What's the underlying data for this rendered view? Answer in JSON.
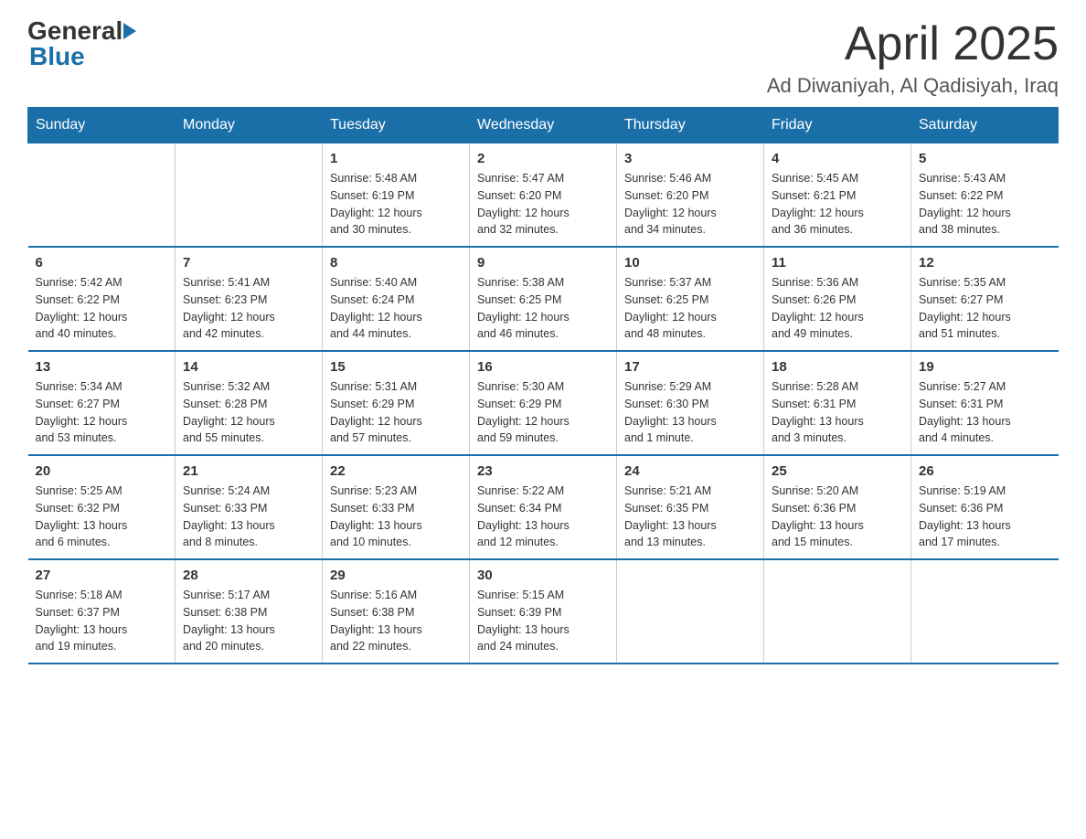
{
  "logo": {
    "text_general": "General",
    "text_blue": "Blue"
  },
  "header": {
    "title": "April 2025",
    "subtitle": "Ad Diwaniyah, Al Qadisiyah, Iraq"
  },
  "days_of_week": [
    "Sunday",
    "Monday",
    "Tuesday",
    "Wednesday",
    "Thursday",
    "Friday",
    "Saturday"
  ],
  "weeks": [
    [
      {
        "day": "",
        "info": ""
      },
      {
        "day": "",
        "info": ""
      },
      {
        "day": "1",
        "info": "Sunrise: 5:48 AM\nSunset: 6:19 PM\nDaylight: 12 hours\nand 30 minutes."
      },
      {
        "day": "2",
        "info": "Sunrise: 5:47 AM\nSunset: 6:20 PM\nDaylight: 12 hours\nand 32 minutes."
      },
      {
        "day": "3",
        "info": "Sunrise: 5:46 AM\nSunset: 6:20 PM\nDaylight: 12 hours\nand 34 minutes."
      },
      {
        "day": "4",
        "info": "Sunrise: 5:45 AM\nSunset: 6:21 PM\nDaylight: 12 hours\nand 36 minutes."
      },
      {
        "day": "5",
        "info": "Sunrise: 5:43 AM\nSunset: 6:22 PM\nDaylight: 12 hours\nand 38 minutes."
      }
    ],
    [
      {
        "day": "6",
        "info": "Sunrise: 5:42 AM\nSunset: 6:22 PM\nDaylight: 12 hours\nand 40 minutes."
      },
      {
        "day": "7",
        "info": "Sunrise: 5:41 AM\nSunset: 6:23 PM\nDaylight: 12 hours\nand 42 minutes."
      },
      {
        "day": "8",
        "info": "Sunrise: 5:40 AM\nSunset: 6:24 PM\nDaylight: 12 hours\nand 44 minutes."
      },
      {
        "day": "9",
        "info": "Sunrise: 5:38 AM\nSunset: 6:25 PM\nDaylight: 12 hours\nand 46 minutes."
      },
      {
        "day": "10",
        "info": "Sunrise: 5:37 AM\nSunset: 6:25 PM\nDaylight: 12 hours\nand 48 minutes."
      },
      {
        "day": "11",
        "info": "Sunrise: 5:36 AM\nSunset: 6:26 PM\nDaylight: 12 hours\nand 49 minutes."
      },
      {
        "day": "12",
        "info": "Sunrise: 5:35 AM\nSunset: 6:27 PM\nDaylight: 12 hours\nand 51 minutes."
      }
    ],
    [
      {
        "day": "13",
        "info": "Sunrise: 5:34 AM\nSunset: 6:27 PM\nDaylight: 12 hours\nand 53 minutes."
      },
      {
        "day": "14",
        "info": "Sunrise: 5:32 AM\nSunset: 6:28 PM\nDaylight: 12 hours\nand 55 minutes."
      },
      {
        "day": "15",
        "info": "Sunrise: 5:31 AM\nSunset: 6:29 PM\nDaylight: 12 hours\nand 57 minutes."
      },
      {
        "day": "16",
        "info": "Sunrise: 5:30 AM\nSunset: 6:29 PM\nDaylight: 12 hours\nand 59 minutes."
      },
      {
        "day": "17",
        "info": "Sunrise: 5:29 AM\nSunset: 6:30 PM\nDaylight: 13 hours\nand 1 minute."
      },
      {
        "day": "18",
        "info": "Sunrise: 5:28 AM\nSunset: 6:31 PM\nDaylight: 13 hours\nand 3 minutes."
      },
      {
        "day": "19",
        "info": "Sunrise: 5:27 AM\nSunset: 6:31 PM\nDaylight: 13 hours\nand 4 minutes."
      }
    ],
    [
      {
        "day": "20",
        "info": "Sunrise: 5:25 AM\nSunset: 6:32 PM\nDaylight: 13 hours\nand 6 minutes."
      },
      {
        "day": "21",
        "info": "Sunrise: 5:24 AM\nSunset: 6:33 PM\nDaylight: 13 hours\nand 8 minutes."
      },
      {
        "day": "22",
        "info": "Sunrise: 5:23 AM\nSunset: 6:33 PM\nDaylight: 13 hours\nand 10 minutes."
      },
      {
        "day": "23",
        "info": "Sunrise: 5:22 AM\nSunset: 6:34 PM\nDaylight: 13 hours\nand 12 minutes."
      },
      {
        "day": "24",
        "info": "Sunrise: 5:21 AM\nSunset: 6:35 PM\nDaylight: 13 hours\nand 13 minutes."
      },
      {
        "day": "25",
        "info": "Sunrise: 5:20 AM\nSunset: 6:36 PM\nDaylight: 13 hours\nand 15 minutes."
      },
      {
        "day": "26",
        "info": "Sunrise: 5:19 AM\nSunset: 6:36 PM\nDaylight: 13 hours\nand 17 minutes."
      }
    ],
    [
      {
        "day": "27",
        "info": "Sunrise: 5:18 AM\nSunset: 6:37 PM\nDaylight: 13 hours\nand 19 minutes."
      },
      {
        "day": "28",
        "info": "Sunrise: 5:17 AM\nSunset: 6:38 PM\nDaylight: 13 hours\nand 20 minutes."
      },
      {
        "day": "29",
        "info": "Sunrise: 5:16 AM\nSunset: 6:38 PM\nDaylight: 13 hours\nand 22 minutes."
      },
      {
        "day": "30",
        "info": "Sunrise: 5:15 AM\nSunset: 6:39 PM\nDaylight: 13 hours\nand 24 minutes."
      },
      {
        "day": "",
        "info": ""
      },
      {
        "day": "",
        "info": ""
      },
      {
        "day": "",
        "info": ""
      }
    ]
  ]
}
